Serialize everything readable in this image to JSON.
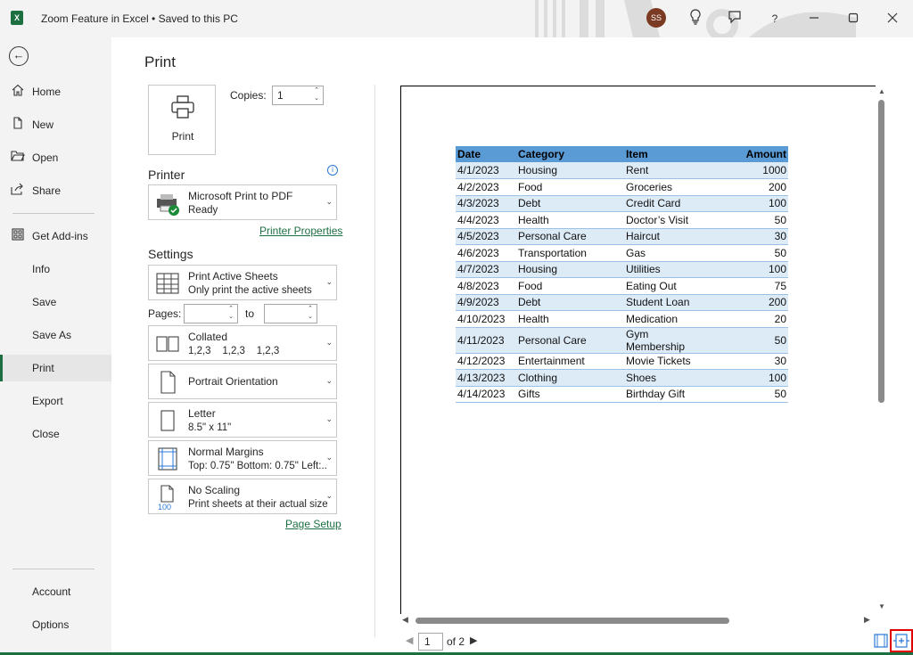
{
  "titlebar": {
    "app_icon": "X",
    "doc_title": "Zoom Feature in Excel • Saved to this PC",
    "avatar_initials": "SS",
    "help_label": "?"
  },
  "nav": {
    "items": [
      {
        "label": "Home",
        "icon": "home-icon"
      },
      {
        "label": "New",
        "icon": "new-file-icon"
      },
      {
        "label": "Open",
        "icon": "open-folder-icon"
      },
      {
        "label": "Share",
        "icon": "share-icon"
      },
      {
        "label": "Get Add-ins",
        "icon": "add-ins-icon"
      },
      {
        "label": "Info"
      },
      {
        "label": "Save"
      },
      {
        "label": "Save As"
      },
      {
        "label": "Print",
        "active": true
      },
      {
        "label": "Export"
      },
      {
        "label": "Close"
      },
      {
        "label": "Account"
      },
      {
        "label": "Options"
      }
    ]
  },
  "print": {
    "title": "Print",
    "button_label": "Print",
    "copies_label": "Copies:",
    "copies_value": "1",
    "printer_heading": "Printer",
    "printer_name": "Microsoft Print to PDF",
    "printer_status": "Ready",
    "printer_properties": "Printer Properties",
    "settings_heading": "Settings",
    "sheets_main": "Print Active Sheets",
    "sheets_sub": "Only print the active sheets",
    "pages_label": "Pages:",
    "to_label": "to",
    "collated_main": "Collated",
    "collated_sub": "1,2,3    1,2,3    1,2,3",
    "orientation": "Portrait Orientation",
    "paper_main": "Letter",
    "paper_sub": "8.5\" x 11\"",
    "margins_main": "Normal Margins",
    "margins_sub": "Top: 0.75\" Bottom: 0.75\" Left:...",
    "scaling_main": "No Scaling",
    "scaling_sub": "Print sheets at their actual size",
    "scaling_icon_text": "100",
    "page_setup": "Page Setup"
  },
  "sheet": {
    "headers": [
      "Date",
      "Category",
      "Item",
      "Amount"
    ],
    "rows": [
      [
        "4/1/2023",
        "Housing",
        "Rent",
        "1000"
      ],
      [
        "4/2/2023",
        "Food",
        "Groceries",
        "200"
      ],
      [
        "4/3/2023",
        "Debt",
        "Credit Card",
        "100"
      ],
      [
        "4/4/2023",
        "Health",
        "Doctor’s Visit",
        "50"
      ],
      [
        "4/5/2023",
        "Personal Care",
        "Haircut",
        "30"
      ],
      [
        "4/6/2023",
        "Transportation",
        "Gas",
        "50"
      ],
      [
        "4/7/2023",
        "Housing",
        "Utilities",
        "100"
      ],
      [
        "4/8/2023",
        "Food",
        "Eating Out",
        "75"
      ],
      [
        "4/9/2023",
        "Debt",
        "Student Loan",
        "200"
      ],
      [
        "4/10/2023",
        "Health",
        "Medication",
        "20"
      ],
      [
        "4/11/2023",
        "Personal Care",
        "Gym Membership",
        "50"
      ],
      [
        "4/12/2023",
        "Entertainment",
        "Movie Tickets",
        "30"
      ],
      [
        "4/13/2023",
        "Clothing",
        "Shoes",
        "100"
      ],
      [
        "4/14/2023",
        "Gifts",
        "Birthday Gift",
        "50"
      ]
    ]
  },
  "pager": {
    "current_page": "1",
    "of_text": "of 2"
  },
  "colors": {
    "accent": "#1d6f42",
    "header_fill": "#5b9bd5",
    "band_fill": "#ddebf7",
    "highlight": "#e00000"
  }
}
